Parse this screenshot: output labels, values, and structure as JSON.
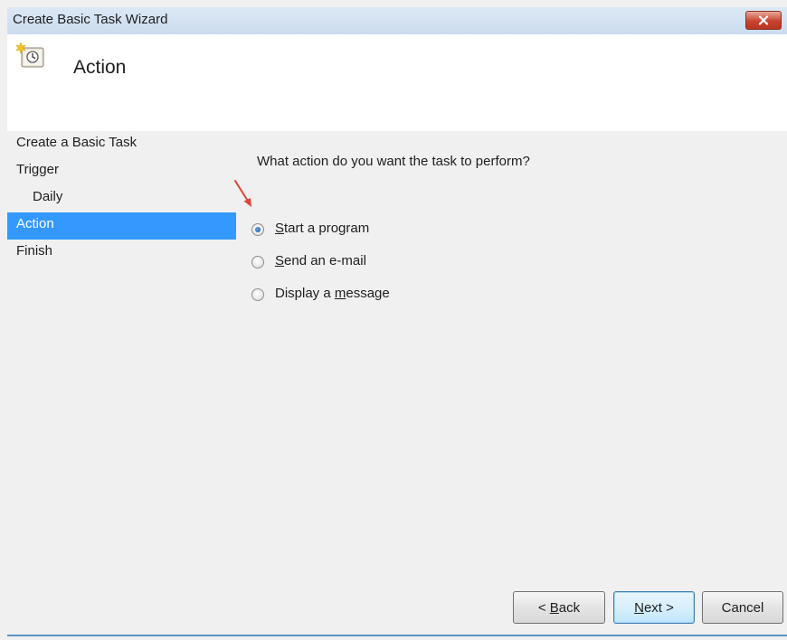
{
  "window": {
    "title": "Create Basic Task Wizard"
  },
  "header": {
    "title": "Action",
    "icon": "task-scheduler-icon"
  },
  "nav": {
    "items": [
      {
        "label": "Create a Basic Task",
        "selected": false
      },
      {
        "label": "Trigger",
        "selected": false
      },
      {
        "label": "Daily",
        "selected": false,
        "indent": true
      },
      {
        "label": "Action",
        "selected": true
      },
      {
        "label": "Finish",
        "selected": false
      }
    ]
  },
  "main": {
    "question": "What action do you want the task to perform?",
    "options": [
      {
        "pre": "",
        "key": "S",
        "post": "tart a program",
        "selected": true
      },
      {
        "pre": "",
        "key": "S",
        "post": "end an e-mail",
        "selected": false
      },
      {
        "pre": "Display a ",
        "key": "m",
        "post": "essage",
        "selected": false
      }
    ]
  },
  "buttons": {
    "back": {
      "pre": "< ",
      "key": "B",
      "post": "ack"
    },
    "next": {
      "pre": "",
      "key": "N",
      "post": "ext >"
    },
    "cancel": {
      "label": "Cancel"
    }
  },
  "colors": {
    "selection": "#3399ff",
    "close_button": "#c8432f",
    "annotation_arrow": "#e0443a"
  }
}
